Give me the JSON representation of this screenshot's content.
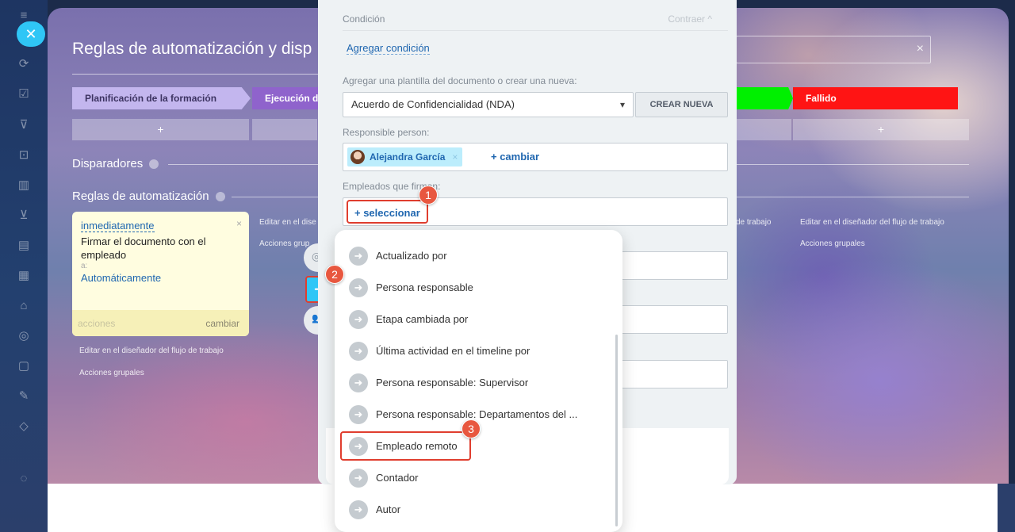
{
  "page": {
    "title": "Reglas de automatización y disp",
    "close_icon": "✕",
    "search_clear": "×"
  },
  "stages": {
    "plan": "Planificación de la formación",
    "exec": "Ejecución de",
    "fail": "Fallido",
    "add": "+",
    "colors": {
      "plan": "#c3b6ee",
      "exec": "#8f63cc",
      "green": "#00f000",
      "fail": "#ff1414"
    }
  },
  "sections": {
    "triggers": "Disparadores",
    "rules": "Reglas de automatización"
  },
  "rule_card": {
    "when": "inmediatamente",
    "close": "×",
    "text": "Firmar el documento con el empleado",
    "to_label": "a:",
    "who": "Automáticamente",
    "actions": "acciones",
    "change": "cambiar"
  },
  "links": {
    "edit_designer": "Editar en el diseñador del flujo de trabajo",
    "group_actions": "Acciones grupales",
    "edit_designer_short": "Editar en el dise",
    "group_actions_short": "Acciones grup",
    "workflow_tail": "de trabajo"
  },
  "modal": {
    "condition_label": "Condición",
    "collapse": "Contraer ^",
    "add_condition": "Agregar condición",
    "template_label": "Agregar una plantilla del documento o crear una nueva:",
    "template_value": "Acuerdo de Confidencialidad (NDA)",
    "create_new": "CREAR NUEVA",
    "responsible_label": "Responsible person:",
    "responsible_user": "Alejandra García",
    "responsible_change": "+ cambiar",
    "signers_label": "Empleados que firman:",
    "signers_select": "+ seleccionar"
  },
  "dropdown": {
    "items": [
      "Actualizado por",
      "Persona responsable",
      "Etapa cambiada por",
      "Última actividad en el timeline por",
      "Persona responsable: Supervisor",
      "Persona responsable: Departamentos del ...",
      "Empleado remoto",
      "Contador",
      "Autor"
    ],
    "highlighted": "Empleado remoto"
  },
  "badges": [
    "1",
    "2",
    "3"
  ],
  "icons": {
    "arrow": "➜",
    "caret": "▾",
    "chat": "◎",
    "people": "👥"
  }
}
